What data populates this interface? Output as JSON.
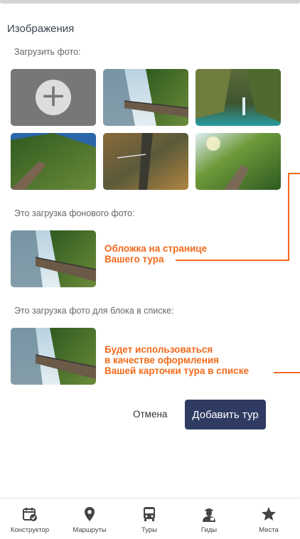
{
  "section_title": "Изображения",
  "upload_label": "Загрузить фото:",
  "background_label": "Это загрузка фонового фото:",
  "background_note": [
    "Обложка на странице",
    "Вашего тура"
  ],
  "list_label": "Это загрузка фото для блока в списке:",
  "list_note": [
    "Будет использоваться",
    "в качестве оформления",
    "Вашей карточки тура в списке"
  ],
  "actions": {
    "cancel": "Отмена",
    "submit": "Добавить тур"
  },
  "nav": {
    "items": [
      {
        "label": "Конструктор",
        "icon": "calendar-check-icon"
      },
      {
        "label": "Маршруты",
        "icon": "map-pin-icon"
      },
      {
        "label": "Туры",
        "icon": "bus-icon"
      },
      {
        "label": "Гиды",
        "icon": "guide-icon"
      },
      {
        "label": "Места",
        "icon": "star-icon"
      }
    ]
  },
  "colors": {
    "accent": "#f26a1b",
    "primary_button": "#2f3b63",
    "nav_icon": "#444444"
  }
}
